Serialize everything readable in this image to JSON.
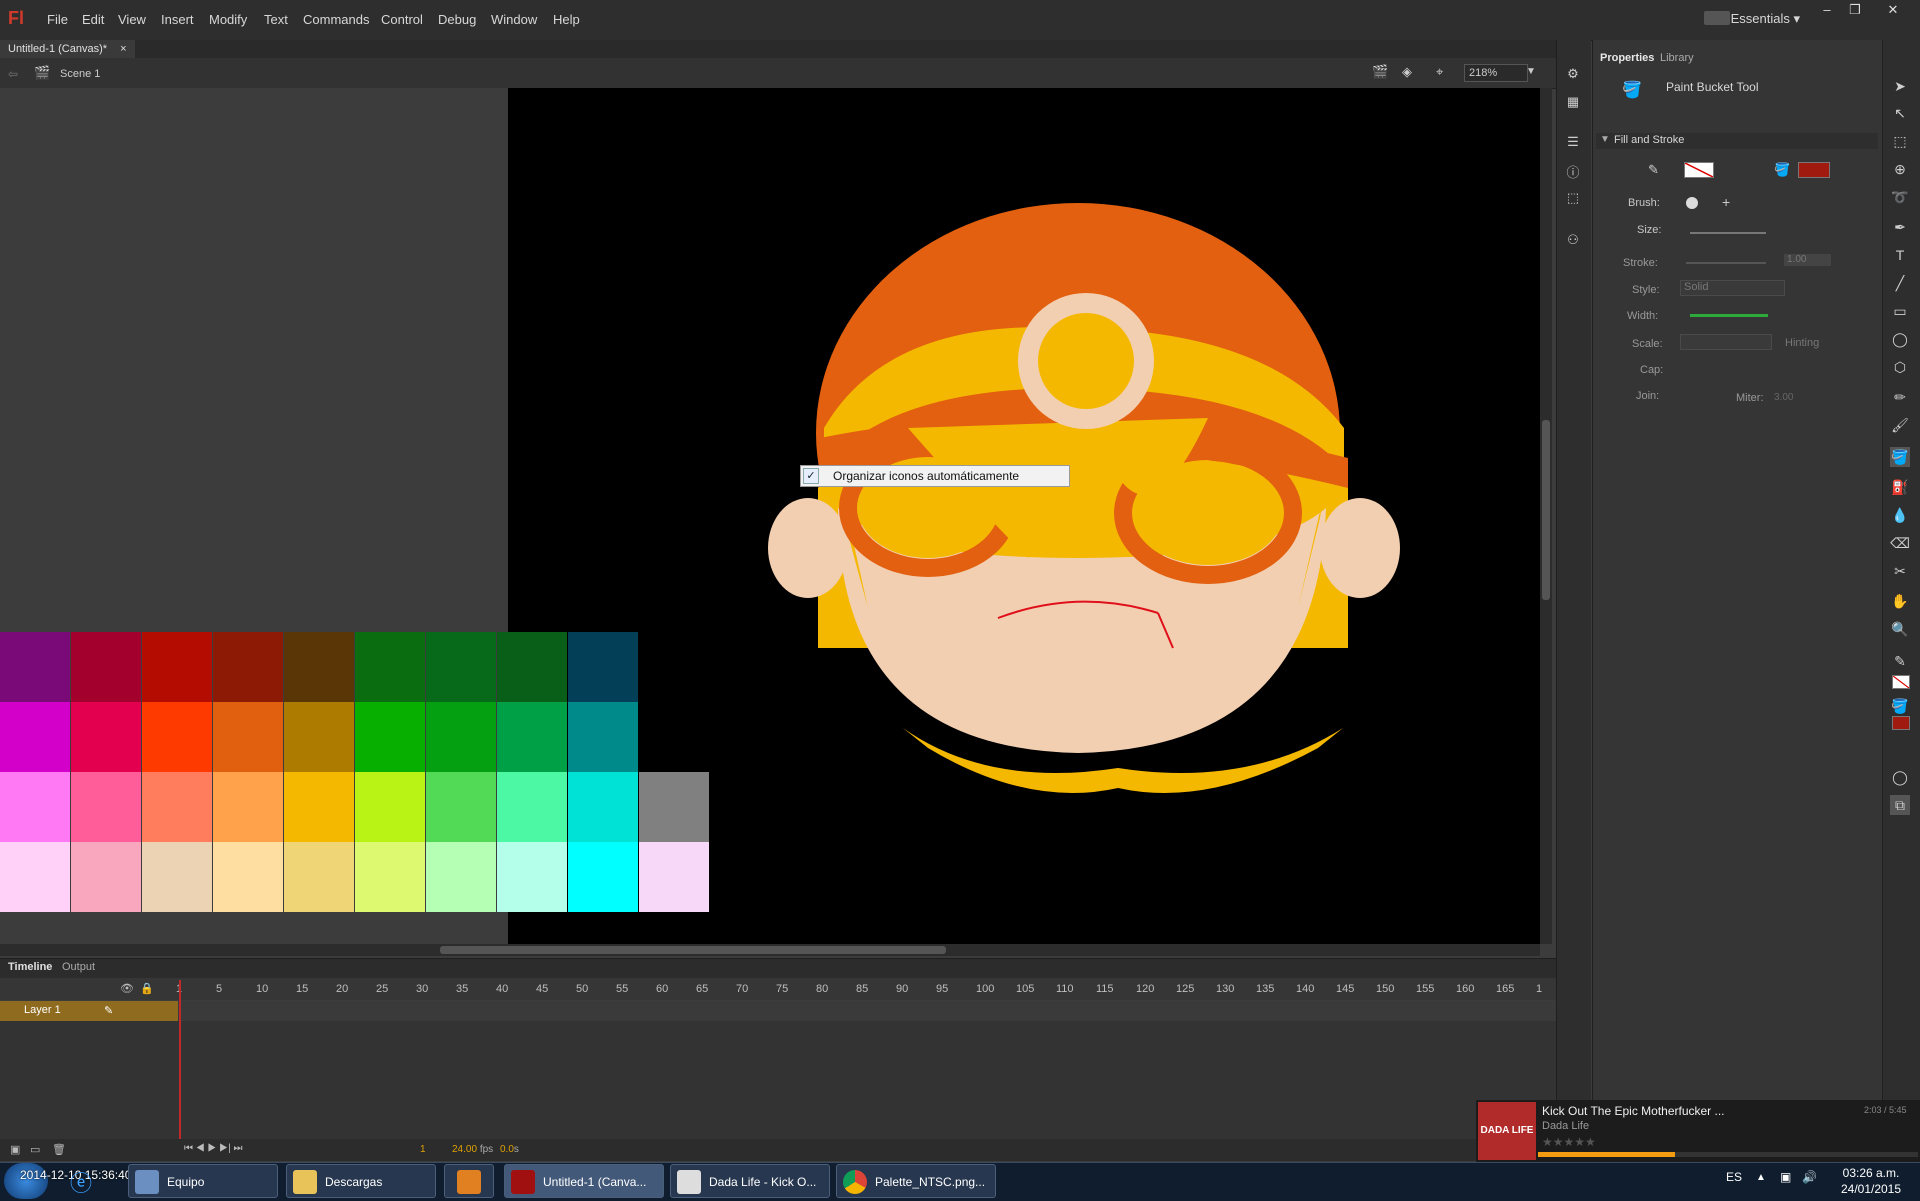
{
  "menu": {
    "logo": "Fl",
    "items": [
      "File",
      "Edit",
      "View",
      "Insert",
      "Modify",
      "Text",
      "Commands",
      "Control",
      "Debug",
      "Window",
      "Help"
    ],
    "workspace": "Essentials"
  },
  "document": {
    "tab": "Untitled-1 (Canvas)*",
    "scene": "Scene 1",
    "zoom": "218%"
  },
  "context_menu": {
    "item": "Organizar iconos automáticamente",
    "checked": true
  },
  "palette": {
    "rows": [
      [
        "#7b0a79",
        "#a4002d",
        "#b40c00",
        "#8c1a05",
        "#5a3505",
        "#0a6d0f",
        "#076a1b",
        "#095e18",
        "#033f57"
      ],
      [
        "#d200c8",
        "#e2004f",
        "#ff3a00",
        "#e06010",
        "#ad7b00",
        "#07b000",
        "#04a011",
        "#00a047",
        "#008a8a"
      ],
      [
        "#ff78f4",
        "#ff5d99",
        "#ff7d5c",
        "#ffa24b",
        "#f5b800",
        "#b9f215",
        "#52d955",
        "#4cf8a3",
        "#00e2d6",
        "#808080"
      ],
      [
        "#ffd0f8",
        "#f9a7bf",
        "#ebd3b3",
        "#ffdfa1",
        "#f0d576",
        "#dcf970",
        "#b4ffb4",
        "#b4ffe9",
        "#00ffff",
        "#f8d8f8"
      ]
    ]
  },
  "timeline": {
    "tabs": [
      "Timeline",
      "Output"
    ],
    "layer": "Layer 1",
    "frame_labels": [
      "1",
      "5",
      "10",
      "15",
      "20",
      "25",
      "30",
      "35",
      "40",
      "45",
      "50",
      "55",
      "60",
      "65",
      "70",
      "75",
      "80",
      "85",
      "90",
      "95",
      "100",
      "105",
      "110",
      "115",
      "120",
      "125",
      "130",
      "135",
      "140",
      "145",
      "150",
      "155",
      "160",
      "165",
      "1"
    ],
    "current_frame": "1",
    "fps": "24.00",
    "fps_unit": "fps",
    "time": "0.0",
    "time_unit": "s"
  },
  "properties": {
    "tabs": [
      "Properties",
      "Library"
    ],
    "tool_name": "Paint Bucket Tool",
    "section": "Fill and Stroke",
    "fill_color": "#a01a10",
    "labels": {
      "brush": "Brush:",
      "size": "Size:",
      "stroke": "Stroke:",
      "style": "Style:",
      "width": "Width:",
      "scale": "Scale:",
      "cap": "Cap:",
      "join": "Join:",
      "miter": "Miter:",
      "hinting": "Hinting"
    },
    "stroke_value": "1.00",
    "style_value": "Solid",
    "miter_value": "3.00"
  },
  "media": {
    "title": "Kick Out The Epic Motherfucker ...",
    "artist": "Dada Life",
    "time": "2:03 / 5:45",
    "art_text": "DADA LIFE",
    "progress": 0.36
  },
  "taskbar": {
    "items": [
      "Equipo",
      "Descargas",
      "",
      "Untitled-1 (Canva...",
      "Dada Life - Kick O...",
      "Palette_NTSC.png..."
    ],
    "overlay_text": "2014-12-10 15:36:40",
    "lang": "ES",
    "clock_time": "03:26 a.m.",
    "clock_date": "24/01/2015"
  }
}
